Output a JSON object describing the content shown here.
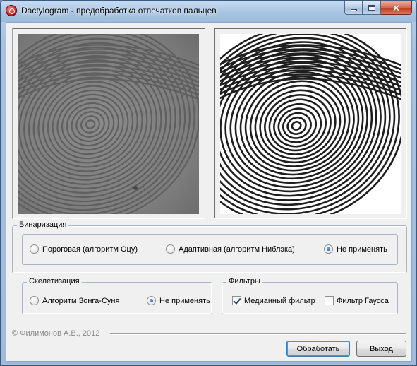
{
  "window": {
    "title": "Dactylogram - предобработка отпечатков пальцев",
    "controls": [
      "minimize-icon",
      "maximize-icon",
      "close-icon"
    ]
  },
  "images": {
    "original": "fingerprint-original",
    "processed": "fingerprint-binarized"
  },
  "binarization": {
    "label": "Бинаризация",
    "options": [
      {
        "label": "Пороговая (алгоритм Оцу)",
        "checked": false
      },
      {
        "label": "Адаптивная (алгоритм Ниблэка)",
        "checked": false
      },
      {
        "label": "Не применять",
        "checked": true
      }
    ]
  },
  "skeletonization": {
    "label": "Скелетизация",
    "options": [
      {
        "label": "Алгоритм Зонга-Суня",
        "checked": false
      },
      {
        "label": "Не применять",
        "checked": true
      }
    ]
  },
  "filters": {
    "label": "Фильтры",
    "options": [
      {
        "label": "Медианный фильтр",
        "checked": true
      },
      {
        "label": "Фильтр Гаусса",
        "checked": false
      }
    ]
  },
  "footer": {
    "copyright": "© Филимонов А.В., 2012",
    "process_button": "Обработать",
    "exit_button": "Выход"
  },
  "colors": {
    "title_bar": "#a8c4e3",
    "client_bg": "#f0f0f0",
    "close_button": "#c2361a"
  }
}
